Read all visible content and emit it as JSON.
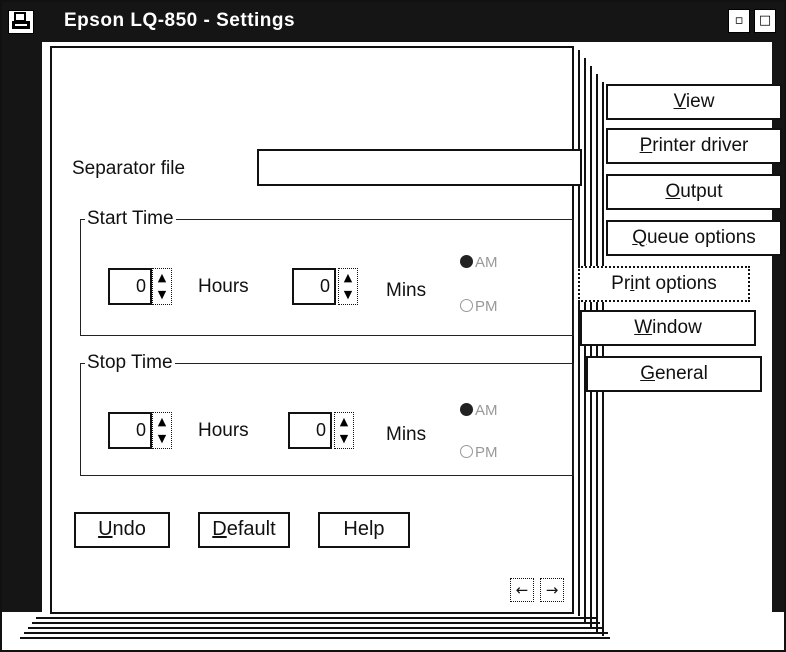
{
  "window": {
    "title": "Epson LQ-850 - Settings",
    "minimize_glyph": "▫",
    "maximize_glyph": "□"
  },
  "separator": {
    "label": "Separator file",
    "value": ""
  },
  "start_time": {
    "legend": "Start Time",
    "hours_value": "0",
    "hours_label": "Hours",
    "mins_value": "0",
    "mins_label": "Mins",
    "am_label": "AM",
    "pm_label": "PM",
    "selected": "AM"
  },
  "stop_time": {
    "legend": "Stop Time",
    "hours_value": "0",
    "hours_label": "Hours",
    "mins_value": "0",
    "mins_label": "Mins",
    "am_label": "AM",
    "pm_label": "PM",
    "selected": "AM"
  },
  "buttons": {
    "undo": {
      "accel": "U",
      "rest": "ndo"
    },
    "default": {
      "accel": "D",
      "rest": "efault"
    },
    "help": "Help"
  },
  "page_nav": {
    "prev_glyph": "←",
    "next_glyph": "→"
  },
  "tabs": [
    {
      "pre": "",
      "accel": "V",
      "post": "iew"
    },
    {
      "pre": "",
      "accel": "P",
      "post": "rinter driver"
    },
    {
      "pre": "",
      "accel": "O",
      "post": "utput"
    },
    {
      "pre": "",
      "accel": "Q",
      "post": "ueue options"
    },
    {
      "pre": "Pr",
      "accel": "i",
      "post": "nt options"
    },
    {
      "pre": "",
      "accel": "W",
      "post": "indow"
    },
    {
      "pre": "",
      "accel": "G",
      "post": "eneral"
    }
  ],
  "active_tab": "Print options"
}
